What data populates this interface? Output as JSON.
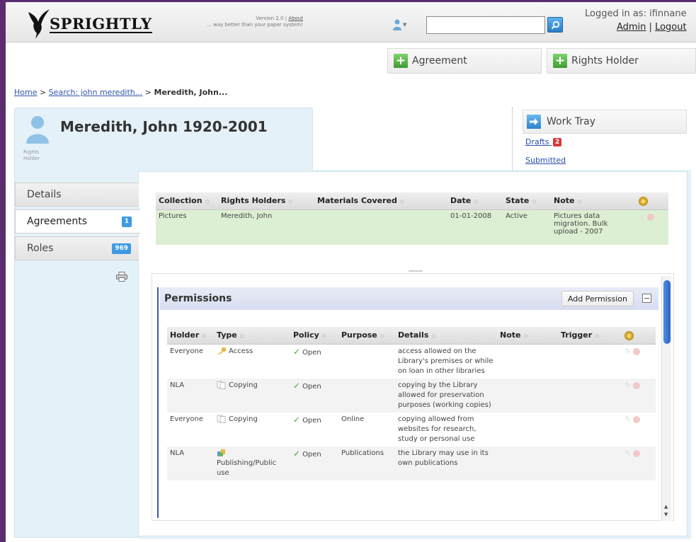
{
  "header": {
    "logo_text": "SPRIGHTLY",
    "version_line": "Version 2.0 | ",
    "about_link": "About",
    "tagline": "... way better than your paper system!",
    "search_placeholder": "",
    "logged_in_text": "Logged in as: ifinnane",
    "admin_link": "Admin",
    "separator": "|",
    "logout_link": "Logout"
  },
  "actions": {
    "agreement_label": "Agreement",
    "rights_holder_label": "Rights Holder"
  },
  "breadcrumb": {
    "home": "Home",
    "sep": ">",
    "search": "Search: john meredith...",
    "current": "Meredith, John..."
  },
  "profile": {
    "title": "Meredith, John 1920-2001",
    "role_line1": "Rights",
    "role_line2": "Holder"
  },
  "work_tray": {
    "label": "Work Tray",
    "drafts_label": "Drafts",
    "drafts_count": "2",
    "submitted_label": "Submitted"
  },
  "nav": {
    "items": [
      {
        "label": "Details",
        "badge": ""
      },
      {
        "label": "Agreements",
        "badge": "1"
      },
      {
        "label": "Roles",
        "badge": "969"
      }
    ]
  },
  "agreements_table": {
    "headers": [
      "Collection",
      "Rights Holders",
      "Materials Covered",
      "Date",
      "State",
      "Note"
    ],
    "rows": [
      {
        "collection": "Pictures",
        "rights_holders": "Meredith, John",
        "materials": "",
        "date": "01-01-2008",
        "state": "Active",
        "note": "Pictures data migration. Bulk upload - 2007"
      }
    ]
  },
  "permissions": {
    "title": "Permissions",
    "add_label": "Add Permission",
    "headers": [
      "Holder",
      "Type",
      "Policy",
      "Purpose",
      "Details",
      "Note",
      "Trigger"
    ],
    "rows": [
      {
        "holder": "Everyone",
        "type": "Access",
        "type_icon": "key-icon",
        "policy": "Open",
        "purpose": "",
        "details": "access allowed on the Library's premises or while on loan in other libraries",
        "note": "",
        "trigger": ""
      },
      {
        "holder": "NLA",
        "type": "Copying",
        "type_icon": "copy-icon",
        "policy": "Open",
        "purpose": "",
        "details": "copying by the Library allowed for preservation purposes (working copies)",
        "note": "",
        "trigger": ""
      },
      {
        "holder": "Everyone",
        "type": "Copying",
        "type_icon": "copy-icon",
        "policy": "Open",
        "purpose": "Online",
        "details": "copying allowed from websites for research, study or personal use",
        "note": "",
        "trigger": ""
      },
      {
        "holder": "NLA",
        "type": "Publishing/Public use",
        "type_icon": "publish-icon",
        "policy": "Open",
        "purpose": "Publications",
        "details": "the Library may use in its own publications",
        "note": "",
        "trigger": ""
      }
    ]
  },
  "colors": {
    "brand_purple": "#5b2d6e",
    "accent_blue": "#3d9ae3",
    "success_green": "#4aa533",
    "alert_red": "#d8383b"
  }
}
